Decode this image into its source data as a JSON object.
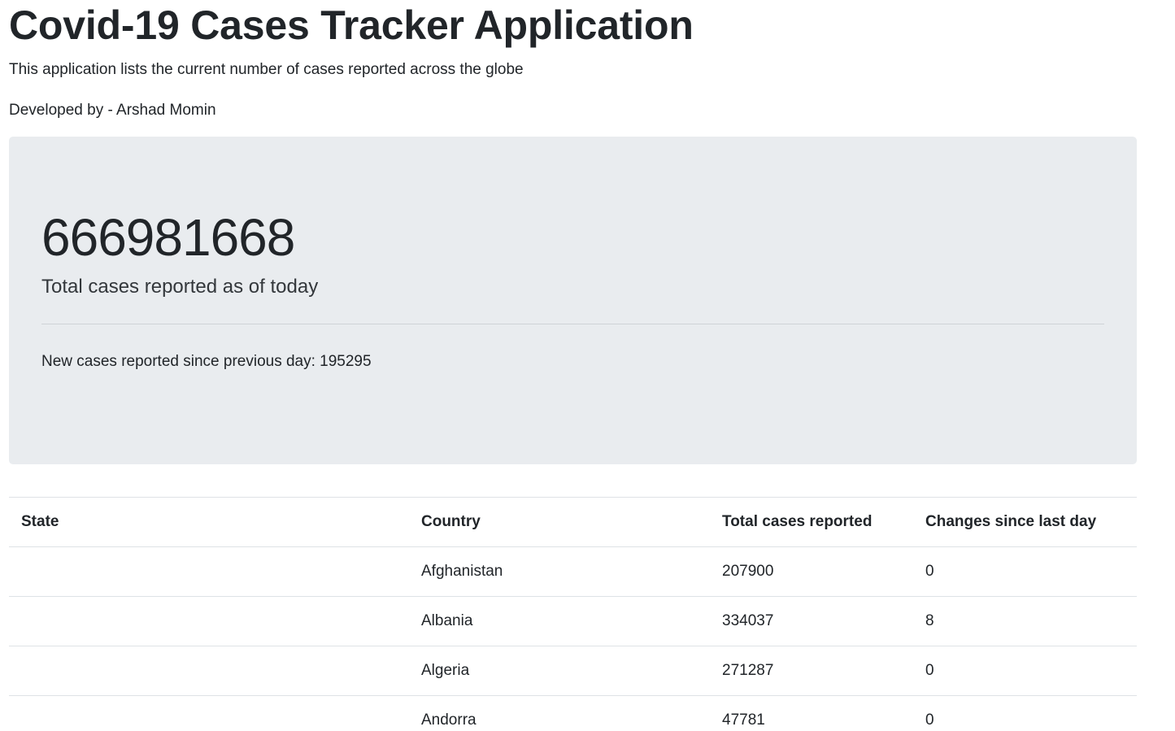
{
  "header": {
    "title": "Covid-19 Cases Tracker Application",
    "subtitle": "This application lists the current number of cases reported across the globe",
    "credit": "Developed by - Arshad Momin"
  },
  "summary": {
    "total_cases": "666981668",
    "total_label": "Total cases reported as of today",
    "new_cases_text": "New cases reported since previous day: 195295"
  },
  "table": {
    "headers": [
      "State",
      "Country",
      "Total cases reported",
      "Changes since last day"
    ],
    "rows": [
      {
        "state": "",
        "country": "Afghanistan",
        "total": "207900",
        "change": "0"
      },
      {
        "state": "",
        "country": "Albania",
        "total": "334037",
        "change": "8"
      },
      {
        "state": "",
        "country": "Algeria",
        "total": "271287",
        "change": "0"
      },
      {
        "state": "",
        "country": "Andorra",
        "total": "47781",
        "change": "0"
      }
    ]
  },
  "colors": {
    "jumbotron_bg": "#e9ecef",
    "text": "#212529",
    "border": "#dee2e6"
  }
}
